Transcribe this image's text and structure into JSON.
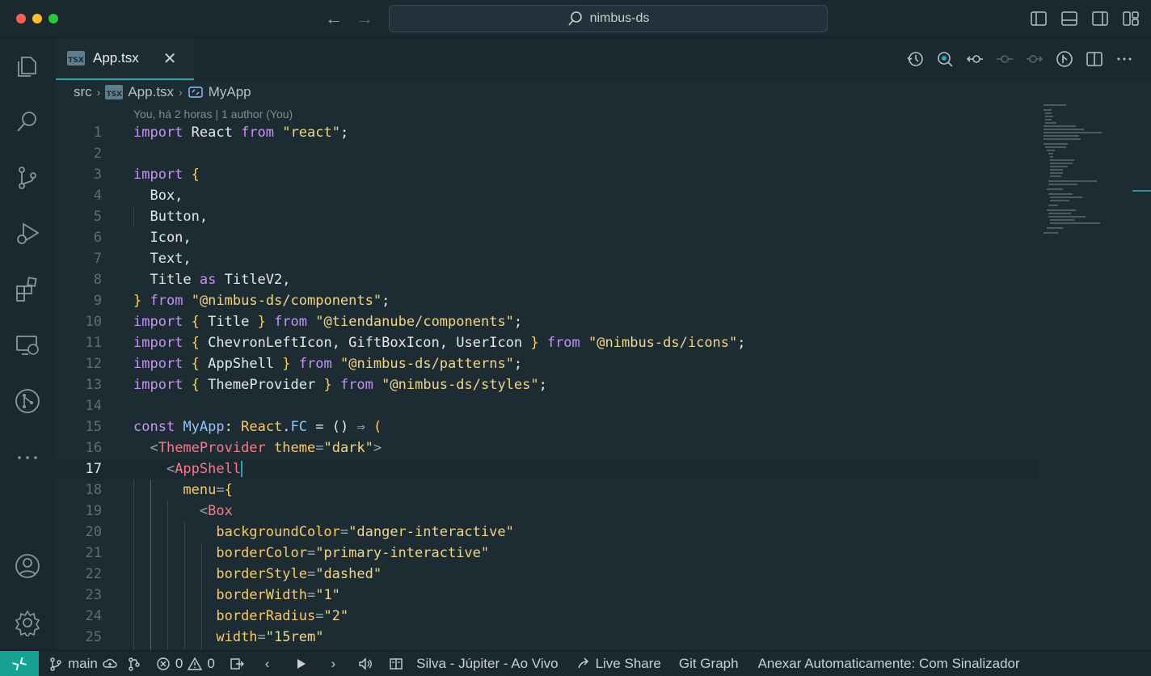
{
  "window": {
    "title": "nimbus-ds"
  },
  "tab": {
    "label": "App.tsx",
    "icon_text": "TSX"
  },
  "breadcrumb": {
    "folder": "src",
    "file": "App.tsx",
    "symbol": "MyApp"
  },
  "blame": "You, há 2 horas | 1 author (You)",
  "active_line": 17,
  "line_numbers": [
    "1",
    "2",
    "3",
    "4",
    "5",
    "6",
    "7",
    "8",
    "9",
    "10",
    "11",
    "12",
    "13",
    "14",
    "15",
    "16",
    "17",
    "18",
    "19",
    "20",
    "21",
    "22",
    "23",
    "24",
    "25"
  ],
  "code": {
    "l1": [
      "import",
      " React ",
      "from",
      " ",
      "\"react\"",
      ";"
    ],
    "l3": [
      "import",
      " ",
      "{"
    ],
    "l4": "  Box,",
    "l5": "  Button,",
    "l6": "  Icon,",
    "l7": "  Text,",
    "l8": [
      "  Title ",
      "as",
      " TitleV2,"
    ],
    "l9": [
      "}",
      " ",
      "from",
      " ",
      "\"@nimbus-ds/components\"",
      ";"
    ],
    "l10": [
      "import",
      " ",
      "{",
      " Title ",
      "}",
      " ",
      "from",
      " ",
      "\"@tiendanube/components\"",
      ";"
    ],
    "l11": [
      "import",
      " ",
      "{",
      " ChevronLeftIcon, GiftBoxIcon, UserIcon ",
      "}",
      " ",
      "from",
      " ",
      "\"@nimbus-ds/icons\"",
      ";"
    ],
    "l12": [
      "import",
      " ",
      "{",
      " AppShell ",
      "}",
      " ",
      "from",
      " ",
      "\"@nimbus-ds/patterns\"",
      ";"
    ],
    "l13": [
      "import",
      " ",
      "{",
      " ThemeProvider ",
      "}",
      " ",
      "from",
      " ",
      "\"@nimbus-ds/styles\"",
      ";"
    ],
    "l15": [
      "const",
      " ",
      "MyApp",
      ": ",
      "React",
      ".",
      "FC",
      " = () ",
      "⇒",
      " ",
      "("
    ],
    "l16": [
      "  <",
      "ThemeProvider",
      " ",
      "theme",
      "=",
      "\"dark\"",
      ">"
    ],
    "l17": [
      "    <",
      "AppShell"
    ],
    "l18": [
      "      ",
      "menu",
      "=",
      "{"
    ],
    "l19": [
      "        <",
      "Box"
    ],
    "l20": [
      "          ",
      "backgroundColor",
      "=",
      "\"danger-interactive\""
    ],
    "l21": [
      "          ",
      "borderColor",
      "=",
      "\"primary-interactive\""
    ],
    "l22": [
      "          ",
      "borderStyle",
      "=",
      "\"dashed\""
    ],
    "l23": [
      "          ",
      "borderWidth",
      "=",
      "\"1\""
    ],
    "l24": [
      "          ",
      "borderRadius",
      "=",
      "\"2\""
    ],
    "l25": [
      "          ",
      "width",
      "=",
      "\"15rem\""
    ]
  },
  "statusbar": {
    "branch": "main",
    "errors": "0",
    "warnings": "0",
    "music": "Silva - Júpiter - Ao Vivo",
    "live_share": "Live Share",
    "git_graph": "Git Graph",
    "auto_attach": "Anexar Automaticamente: Com Sinalizador"
  },
  "icons": [
    "search-icon",
    "explorer-icon",
    "source-control-icon",
    "run-debug-icon",
    "extensions-icon",
    "remote-explorer-icon",
    "git-graph-icon",
    "more-icon",
    "account-icon",
    "settings-gear-icon"
  ],
  "colors": {
    "accent": "#27a9b5",
    "remote_indicator": "#16a394",
    "keyword": "#c594f5",
    "string": "#f0d58c",
    "tag": "#f77b8a"
  }
}
